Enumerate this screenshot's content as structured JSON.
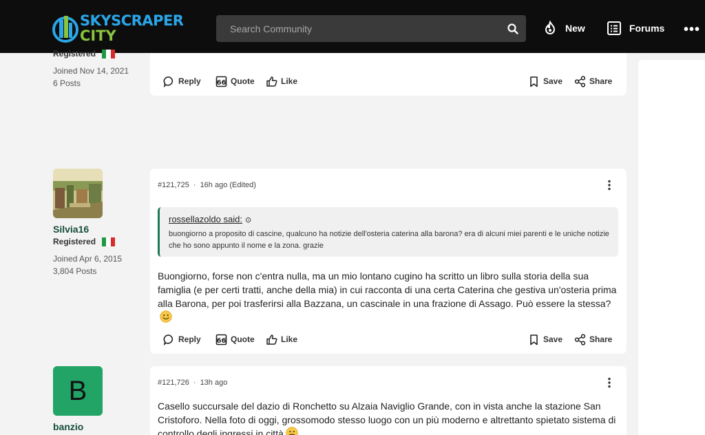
{
  "header": {
    "logo_line1": "SKYSCRAPER",
    "logo_line2": "CITY",
    "search_placeholder": "Search Community",
    "new_label": "New",
    "forums_label": "Forums",
    "more_label": "•••"
  },
  "colors": {
    "header_bg": "#0d0d0d",
    "logo_blue": "#2aa6e8",
    "logo_green": "#8ac43f",
    "quote_border": "#1a7a53",
    "avatar_b_bg": "#21a466",
    "username": "#154d3a"
  },
  "actions": {
    "reply": "Reply",
    "quote": "Quote",
    "like": "Like",
    "save": "Save",
    "share": "Share"
  },
  "posts": [
    {
      "user": {
        "role": "Registered",
        "joined": "Joined Nov 14, 2021",
        "posts": "6 Posts",
        "flag": "italy-flag-icon"
      }
    },
    {
      "meta": {
        "number": "#121,725",
        "time": "16h ago (Edited)"
      },
      "user": {
        "name": "Silvia16",
        "role": "Registered",
        "joined": "Joined Apr 6, 2015",
        "posts": "3,804 Posts",
        "flag": "italy-flag-icon"
      },
      "quote": {
        "author": "rossellazoldo said:",
        "text": "buongiorno a proposito di cascine, qualcuno ha notizie dell'osteria caterina alla barona? era di alcuni miei parenti e le uniche notizie che ho sono appunto il nome e la zona. grazie"
      },
      "body": "Buongiorno, forse non c'entra nulla, ma un mio lontano cugino ha scritto un libro sulla storia della sua famiglia (e per certi tratti, anche della mia) in cui racconta di una certa Caterina che gestiva un'osteria prima alla Barona, per poi trasferirsi alla Bazzana, un cascinale in una frazione di Assago. Può essere la stessa?"
    },
    {
      "meta": {
        "number": "#121,726",
        "time": "13h ago"
      },
      "user": {
        "name": "banzio",
        "avatar_letter": "B"
      },
      "body": "Casello succursale del dazio di Ronchetto su Alzaia Naviglio Grande, con in vista anche la stazione San Cristoforo. Nella foto di oggi, grossomodo stesso luogo con un più moderno e altrettanto spietato sistema di controllo degli ingressi in città"
    }
  ]
}
